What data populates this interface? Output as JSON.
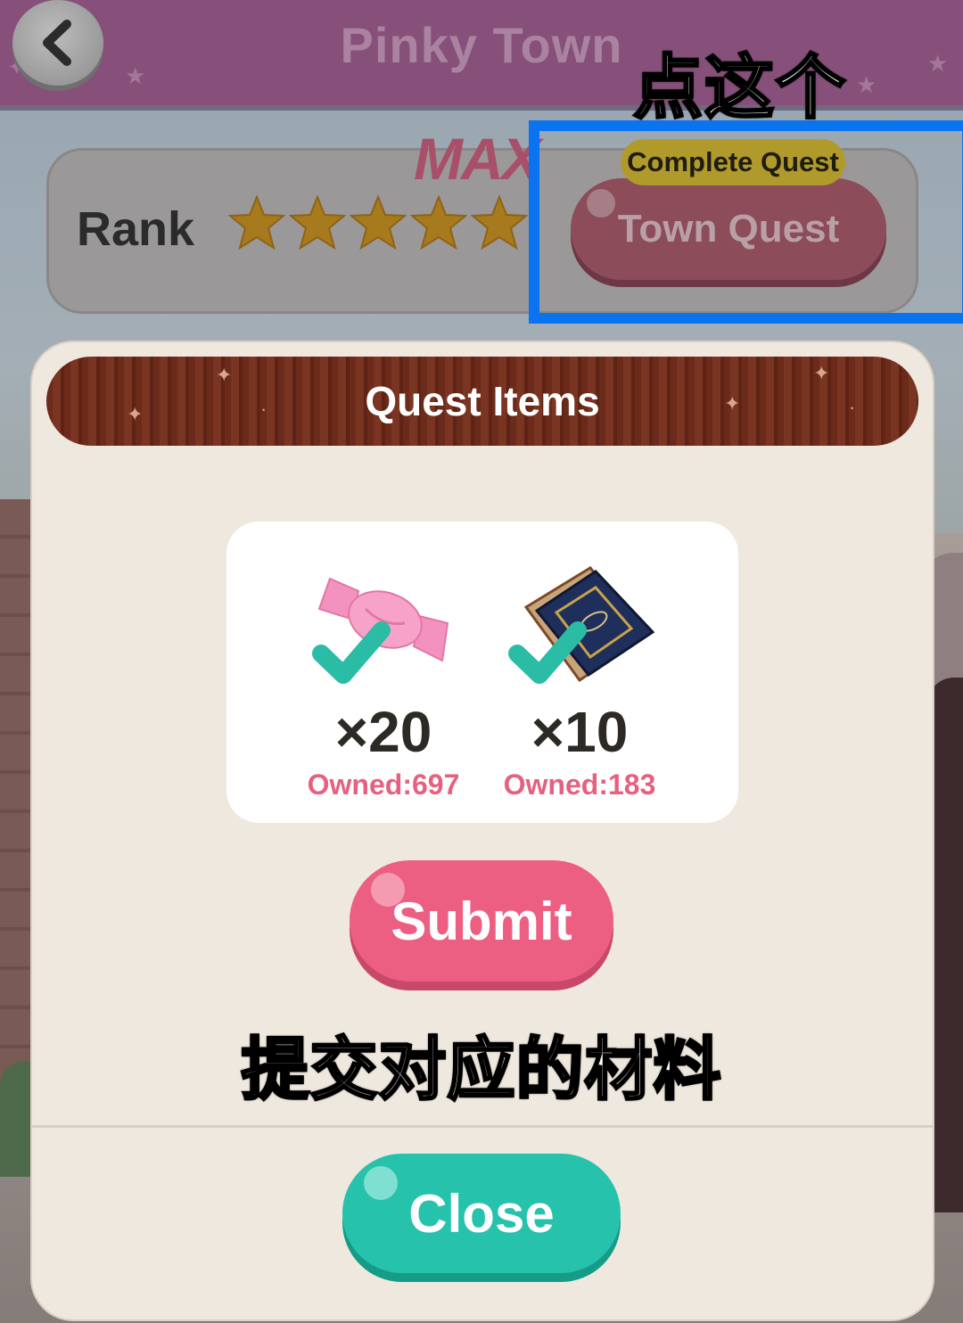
{
  "header": {
    "title": "Pinky Town",
    "back_icon": "chevron-left-icon"
  },
  "rank": {
    "label": "Rank",
    "stars": 5,
    "max_label": "MAX"
  },
  "town_quest": {
    "badge": "Complete Quest",
    "button_label": "Town Quest"
  },
  "annotations": {
    "top": "点这个",
    "middle": "提交对应的材料"
  },
  "dialog": {
    "title": "Quest Items",
    "items": [
      {
        "icon": "pink-candy-icon",
        "quantity": "×20",
        "owned": "Owned:697",
        "checked": true
      },
      {
        "icon": "blue-book-icon",
        "quantity": "×10",
        "owned": "Owned:183",
        "checked": true
      }
    ],
    "submit_label": "Submit",
    "close_label": "Close"
  },
  "colors": {
    "highlight": "#0a73f0",
    "submit": "#ec5f82",
    "close": "#27c2ac",
    "owned_text": "#e6617f"
  }
}
